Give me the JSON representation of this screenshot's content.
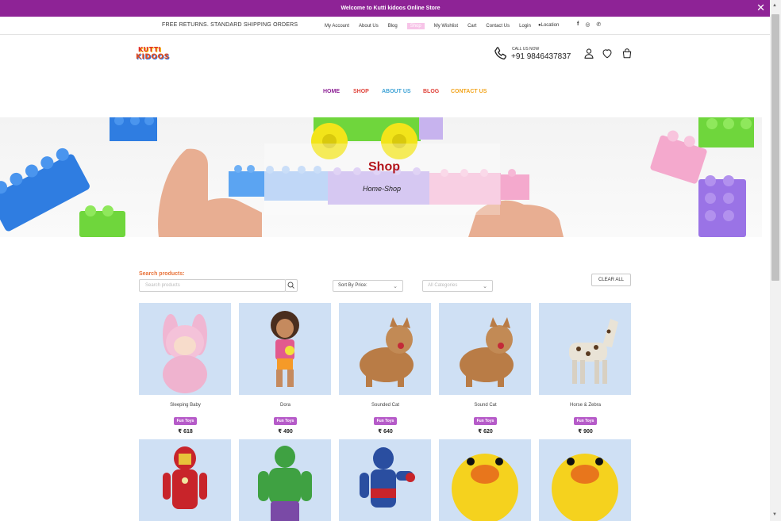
{
  "announcement": {
    "text": "Welcome to Kutti kidoos Online Store",
    "close": "✕"
  },
  "topbar": {
    "promo": "FREE RETURNS. STANDARD SHIPPING ORDERS",
    "links": [
      "My Account",
      "About Us",
      "Blog",
      "Shop",
      "My Wishlist",
      "Cart",
      "Contact Us",
      "Login"
    ],
    "location": "Location",
    "social": [
      "f",
      "◎",
      "✆"
    ]
  },
  "header": {
    "logo_top": "KUTTI",
    "logo_bottom": "KIDOOS",
    "call_label": "CALL US NOW",
    "call_number": "+91 9846437837"
  },
  "nav": {
    "items": [
      "HOME",
      "SHOP",
      "ABOUT US",
      "BLOG",
      "CONTACT US"
    ],
    "colors": [
      "#8e2396",
      "#e0443b",
      "#3fa3d6",
      "#e0443b",
      "#f2a51e"
    ]
  },
  "hero": {
    "title": "Shop",
    "breadcrumb": "Home-Shop"
  },
  "filters": {
    "search_label": "Search products:",
    "search_placeholder": "Search products",
    "sort_value": "Sort By Price:",
    "category_placeholder": "All Categories",
    "clear_label": "CLEAR ALL"
  },
  "products": [
    {
      "name": "Sleeping Baby",
      "tag": "Fun Toys",
      "price": "₹ 618"
    },
    {
      "name": "Dora",
      "tag": "Fun Toys",
      "price": "₹ 490"
    },
    {
      "name": "Sounded Cat",
      "tag": "Fun Toys",
      "price": "₹ 640"
    },
    {
      "name": "Sound Cat",
      "tag": "Fun Toys",
      "price": "₹ 620"
    },
    {
      "name": "Horse & Zebra",
      "tag": "Fun Toys",
      "price": "₹ 900"
    },
    {
      "name": "",
      "tag": "",
      "price": ""
    },
    {
      "name": "",
      "tag": "",
      "price": ""
    },
    {
      "name": "",
      "tag": "",
      "price": ""
    },
    {
      "name": "",
      "tag": "",
      "price": ""
    },
    {
      "name": "",
      "tag": "",
      "price": ""
    }
  ],
  "colors": {
    "brand_purple": "#8e2396",
    "tag_purple": "#b65bc9",
    "accent_orange": "#e8733a",
    "hero_title_red": "#b3161c"
  },
  "icons": [
    "close-icon",
    "location-pin-icon",
    "facebook-icon",
    "instagram-icon",
    "whatsapp-icon",
    "phone-icon",
    "user-icon",
    "heart-icon",
    "cart-icon",
    "search-icon",
    "chevron-down-icon"
  ]
}
